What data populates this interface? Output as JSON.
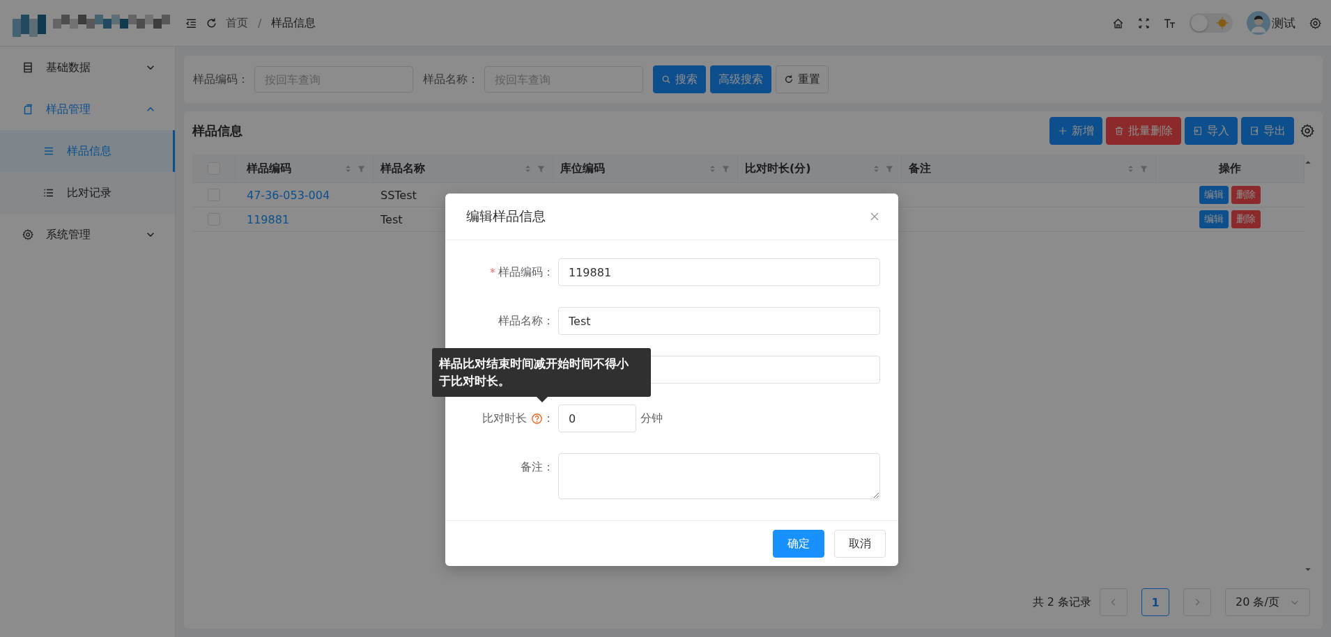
{
  "header": {
    "breadcrumb": [
      {
        "label": "首页",
        "current": false
      },
      {
        "label": "样品信息",
        "current": true
      }
    ],
    "separator": "/",
    "theme_switch": {
      "on": false
    },
    "user": {
      "name": "测试"
    }
  },
  "sidebar": {
    "items": [
      {
        "label": "基础数据",
        "expanded": false,
        "active": false
      },
      {
        "label": "样品管理",
        "expanded": true,
        "active": true,
        "children": [
          {
            "label": "样品信息",
            "selected": true
          },
          {
            "label": "比对记录",
            "selected": false
          }
        ]
      },
      {
        "label": "系统管理",
        "expanded": false,
        "active": false
      }
    ]
  },
  "search_bar": {
    "fields": [
      {
        "label": "样品编码：",
        "placeholder": "按回车查询"
      },
      {
        "label": "样品名称：",
        "placeholder": "按回车查询"
      }
    ],
    "buttons": [
      {
        "label": "搜索",
        "kind": "primary"
      },
      {
        "label": "高级搜索",
        "kind": "primary"
      },
      {
        "label": "重置",
        "kind": "default"
      }
    ]
  },
  "table_panel": {
    "title": "样品信息",
    "toolbar": [
      {
        "label": "新增",
        "kind": "primary"
      },
      {
        "label": "批量删除",
        "kind": "danger"
      },
      {
        "label": "导入",
        "kind": "primary"
      },
      {
        "label": "导出",
        "kind": "primary"
      }
    ],
    "table": {
      "all_checked": false,
      "columns": [
        {
          "label": "样品编码",
          "sortable": true
        },
        {
          "label": "样品名称",
          "sortable": true
        },
        {
          "label": "库位编码",
          "sortable": true
        },
        {
          "label": "比对时长(分)",
          "sortable": true
        },
        {
          "label": "备注",
          "sortable": true
        },
        {
          "label": "操作",
          "sortable": false
        }
      ],
      "rows": [
        {
          "checked": false,
          "code": "47-36-053-004",
          "name": "SSTest",
          "actions": [
            {
              "label": "编辑",
              "kind": "primary"
            },
            {
              "label": "删除",
              "kind": "danger"
            }
          ]
        },
        {
          "checked": false,
          "code": "119881",
          "name": "Test",
          "actions": [
            {
              "label": "编辑",
              "kind": "primary"
            },
            {
              "label": "删除",
              "kind": "danger"
            }
          ]
        }
      ]
    },
    "pagination": {
      "total": "共 2 条记录",
      "pages": [
        {
          "label": "1",
          "selected": true
        }
      ],
      "page_size": "20 条/页"
    }
  },
  "dialog": {
    "title": "编辑样品信息",
    "required_mark": "*",
    "fields": [
      {
        "kind": "input",
        "label": "样品编码：",
        "required": true,
        "value": "119881"
      },
      {
        "kind": "input",
        "label": "样品名称：",
        "required": false,
        "value": "Test"
      },
      {
        "kind": "input"
      },
      {
        "kind": "number",
        "label": "比对时长",
        "help": true,
        "suffix": "：",
        "value": "0",
        "unit": "分钟"
      },
      {
        "kind": "textarea",
        "label": "备注：",
        "required": false
      }
    ],
    "tooltip": "样品比对结束时间减开始时间不得小于比对时长。",
    "buttons": [
      {
        "label": "确定",
        "kind": "primary"
      },
      {
        "label": "取消",
        "kind": "default"
      }
    ]
  }
}
